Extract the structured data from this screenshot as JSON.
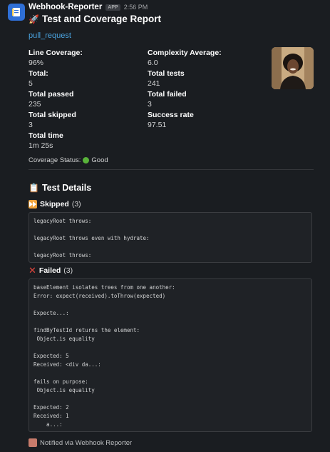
{
  "header": {
    "sender": "Webhook-Reporter",
    "badge": "APP",
    "time": "2:56 PM"
  },
  "title": {
    "emoji": "🚀",
    "text": "Test and Coverage Report"
  },
  "link": "pull_request",
  "fields": {
    "line_coverage": {
      "label": "Line Coverage:",
      "value": "96%"
    },
    "complexity": {
      "label": "Complexity Average:",
      "value": "6.0"
    },
    "total": {
      "label": "Total:",
      "value": "5"
    },
    "total_tests": {
      "label": "Total tests",
      "value": "241"
    },
    "total_passed": {
      "label": "Total passed",
      "value": "235"
    },
    "total_failed": {
      "label": "Total failed",
      "value": "3"
    },
    "total_skipped": {
      "label": "Total skipped",
      "value": "3"
    },
    "success_rate": {
      "label": "Success rate",
      "value": "97.51"
    },
    "total_time": {
      "label": "Total time",
      "value": "1m 25s"
    }
  },
  "coverage_status": {
    "label": "Coverage Status:",
    "value": "Good",
    "color": "#59b33a"
  },
  "details": {
    "heading_emoji": "📋",
    "heading": "Test Details",
    "skipped": {
      "label": "Skipped",
      "count": "(3)",
      "text": "legacyRoot throws:\n\nlegacyRoot throws even with hydrate:\n\nlegacyRoot throws:"
    },
    "failed": {
      "label": "Failed",
      "count": "(3)",
      "text": "baseElement isolates trees from one another:\nError: expect(received).toThrow(expected)\n\nExpecte...:\n\nfindByTestId returns the element:\n Object.is equality\n\nExpected: 5\nReceived: <div da...:\n\nfails on purpose:\n Object.is equality\n\nExpected: 2\nReceived: 1\n    a...:"
    }
  },
  "footer": "Notified via Webhook Reporter",
  "icons": {
    "app": "notebook-icon",
    "skip": "fast-forward-icon",
    "fail": "cross-mark-icon",
    "status": "green-circle-icon"
  }
}
